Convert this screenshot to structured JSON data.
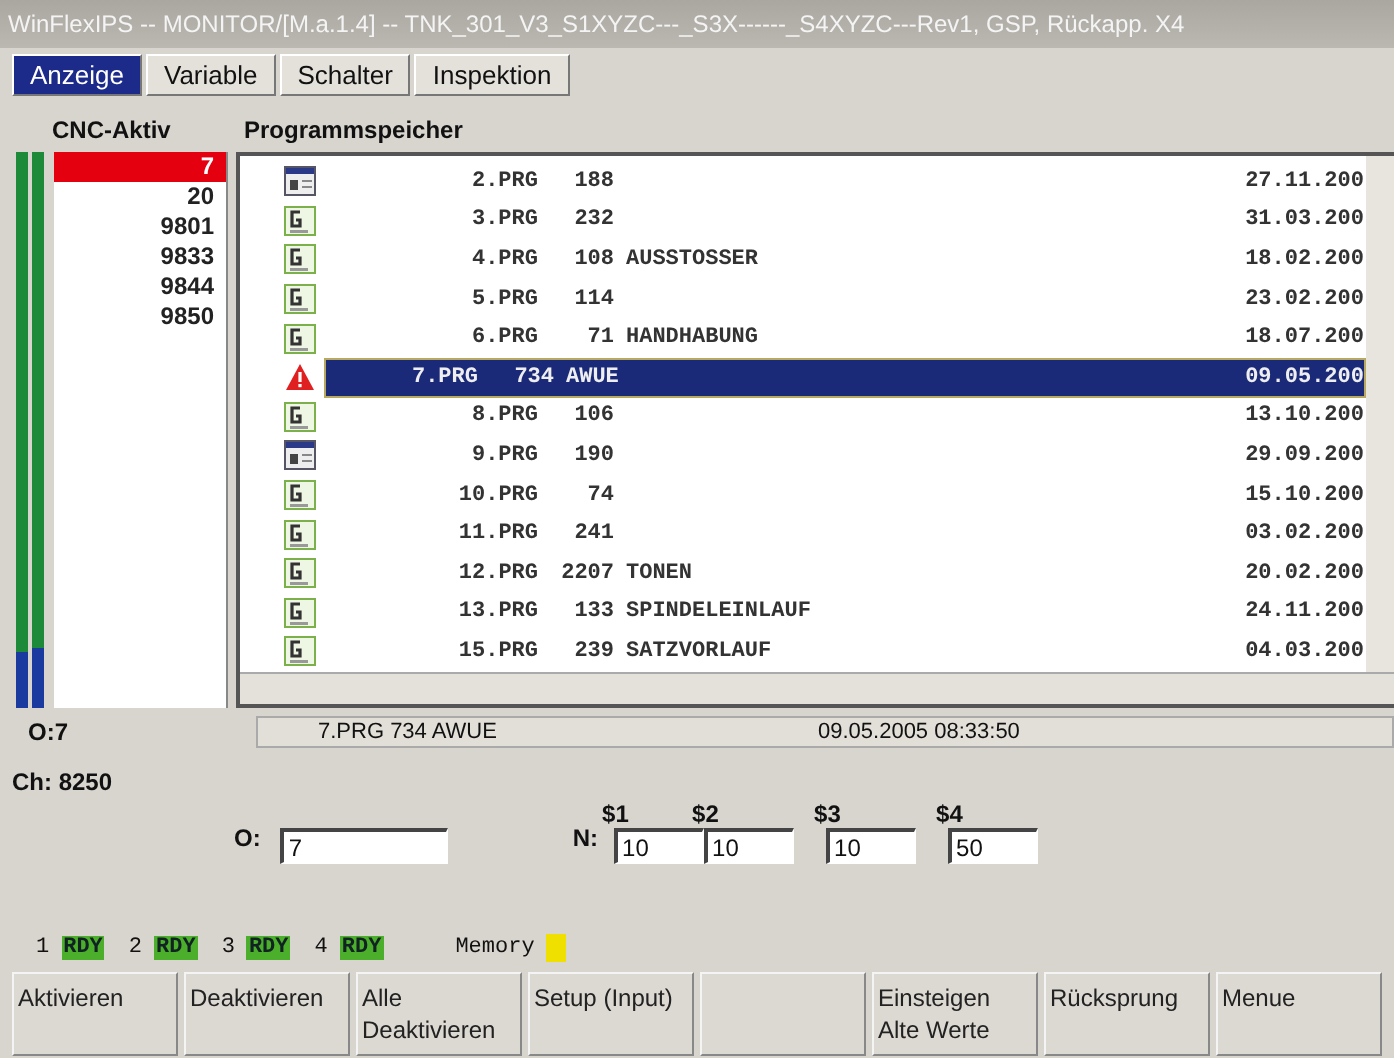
{
  "window": {
    "title": "WinFlexIPS -- MONITOR/[M.a.1.4] -- TNK_301_V3_S1XYZC---_S3X------_S4XYZC---Rev1, GSP, Rückapp. X4"
  },
  "tabs": [
    {
      "label": "Anzeige",
      "selected": true
    },
    {
      "label": "Variable",
      "selected": false
    },
    {
      "label": "Schalter",
      "selected": false
    },
    {
      "label": "Inspektion",
      "selected": false
    }
  ],
  "cnc_active": {
    "title": "CNC-Aktiv",
    "items": [
      {
        "label": "7",
        "selected": true
      },
      {
        "label": "20",
        "selected": false
      },
      {
        "label": "9801",
        "selected": false
      },
      {
        "label": "9833",
        "selected": false
      },
      {
        "label": "9844",
        "selected": false
      },
      {
        "label": "9850",
        "selected": false
      }
    ]
  },
  "program_memory": {
    "title": "Programmspeicher",
    "rows": [
      {
        "kind": "doc",
        "name": "2.PRG",
        "size": "188",
        "comment": "",
        "date": "27.11.200",
        "selected": false
      },
      {
        "kind": "g",
        "name": "3.PRG",
        "size": "232",
        "comment": "",
        "date": "31.03.200",
        "selected": false
      },
      {
        "kind": "g",
        "name": "4.PRG",
        "size": "108",
        "comment": "AUSSTOSSER",
        "date": "18.02.200",
        "selected": false
      },
      {
        "kind": "g",
        "name": "5.PRG",
        "size": "114",
        "comment": "",
        "date": "23.02.200",
        "selected": false
      },
      {
        "kind": "g",
        "name": "6.PRG",
        "size": "71",
        "comment": "HANDHABUNG",
        "date": "18.07.200",
        "selected": false
      },
      {
        "kind": "warning",
        "name": "7.PRG",
        "size": "734",
        "comment": "AWUE",
        "date": "09.05.200",
        "selected": true
      },
      {
        "kind": "g",
        "name": "8.PRG",
        "size": "106",
        "comment": "",
        "date": "13.10.200",
        "selected": false
      },
      {
        "kind": "doc",
        "name": "9.PRG",
        "size": "190",
        "comment": "",
        "date": "29.09.200",
        "selected": false
      },
      {
        "kind": "g",
        "name": "10.PRG",
        "size": "74",
        "comment": "",
        "date": "15.10.200",
        "selected": false
      },
      {
        "kind": "g",
        "name": "11.PRG",
        "size": "241",
        "comment": "",
        "date": "03.02.200",
        "selected": false
      },
      {
        "kind": "g",
        "name": "12.PRG",
        "size": "2207",
        "comment": "TONEN",
        "date": "20.02.200",
        "selected": false
      },
      {
        "kind": "g",
        "name": "13.PRG",
        "size": "133",
        "comment": "SPINDELEINLAUF",
        "date": "24.11.200",
        "selected": false
      },
      {
        "kind": "g",
        "name": "15.PRG",
        "size": "239",
        "comment": "SATZVORLAUF",
        "date": "04.03.200",
        "selected": false
      }
    ]
  },
  "status": {
    "o": "O:7",
    "program": "7.PRG   734 AWUE",
    "timestamp": "09.05.2005 08:33:50"
  },
  "ch": "Ch: 8250",
  "o_field": {
    "label": "O:",
    "value": "7"
  },
  "n_fields": {
    "label": "N:",
    "fields": [
      {
        "label": "$1",
        "value": "10"
      },
      {
        "label": "$2",
        "value": "10"
      },
      {
        "label": "$3",
        "value": "10"
      },
      {
        "label": "$4",
        "value": "50"
      }
    ]
  },
  "indicators": [
    {
      "number": "1",
      "status": "RDY"
    },
    {
      "number": "2",
      "status": "RDY"
    },
    {
      "number": "3",
      "status": "RDY"
    },
    {
      "number": "4",
      "status": "RDY"
    }
  ],
  "memory": {
    "label": "Memory",
    "color": "#f0e000"
  },
  "buttons": [
    {
      "kind": "key",
      "label": "Aktivieren"
    },
    {
      "kind": "key",
      "label": "Deaktivieren"
    },
    {
      "kind": "key",
      "label": "Alle Deaktivieren"
    },
    {
      "kind": "key",
      "label": "Setup (Input)"
    },
    {
      "kind": "blank"
    },
    {
      "kind": "key",
      "label": "Einsteigen Alte Werte"
    },
    {
      "kind": "key",
      "label": "Rücksprung"
    },
    {
      "kind": "key",
      "label": "Menue"
    }
  ]
}
